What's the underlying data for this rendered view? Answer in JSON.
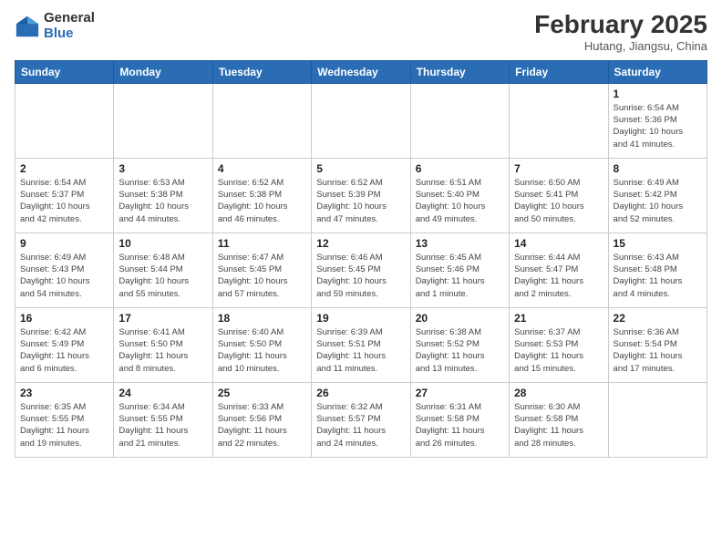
{
  "header": {
    "logo_general": "General",
    "logo_blue": "Blue",
    "month_title": "February 2025",
    "subtitle": "Hutang, Jiangsu, China"
  },
  "weekdays": [
    "Sunday",
    "Monday",
    "Tuesday",
    "Wednesday",
    "Thursday",
    "Friday",
    "Saturday"
  ],
  "weeks": [
    [
      {
        "day": "",
        "info": ""
      },
      {
        "day": "",
        "info": ""
      },
      {
        "day": "",
        "info": ""
      },
      {
        "day": "",
        "info": ""
      },
      {
        "day": "",
        "info": ""
      },
      {
        "day": "",
        "info": ""
      },
      {
        "day": "1",
        "info": "Sunrise: 6:54 AM\nSunset: 5:36 PM\nDaylight: 10 hours\nand 41 minutes."
      }
    ],
    [
      {
        "day": "2",
        "info": "Sunrise: 6:54 AM\nSunset: 5:37 PM\nDaylight: 10 hours\nand 42 minutes."
      },
      {
        "day": "3",
        "info": "Sunrise: 6:53 AM\nSunset: 5:38 PM\nDaylight: 10 hours\nand 44 minutes."
      },
      {
        "day": "4",
        "info": "Sunrise: 6:52 AM\nSunset: 5:38 PM\nDaylight: 10 hours\nand 46 minutes."
      },
      {
        "day": "5",
        "info": "Sunrise: 6:52 AM\nSunset: 5:39 PM\nDaylight: 10 hours\nand 47 minutes."
      },
      {
        "day": "6",
        "info": "Sunrise: 6:51 AM\nSunset: 5:40 PM\nDaylight: 10 hours\nand 49 minutes."
      },
      {
        "day": "7",
        "info": "Sunrise: 6:50 AM\nSunset: 5:41 PM\nDaylight: 10 hours\nand 50 minutes."
      },
      {
        "day": "8",
        "info": "Sunrise: 6:49 AM\nSunset: 5:42 PM\nDaylight: 10 hours\nand 52 minutes."
      }
    ],
    [
      {
        "day": "9",
        "info": "Sunrise: 6:49 AM\nSunset: 5:43 PM\nDaylight: 10 hours\nand 54 minutes."
      },
      {
        "day": "10",
        "info": "Sunrise: 6:48 AM\nSunset: 5:44 PM\nDaylight: 10 hours\nand 55 minutes."
      },
      {
        "day": "11",
        "info": "Sunrise: 6:47 AM\nSunset: 5:45 PM\nDaylight: 10 hours\nand 57 minutes."
      },
      {
        "day": "12",
        "info": "Sunrise: 6:46 AM\nSunset: 5:45 PM\nDaylight: 10 hours\nand 59 minutes."
      },
      {
        "day": "13",
        "info": "Sunrise: 6:45 AM\nSunset: 5:46 PM\nDaylight: 11 hours\nand 1 minute."
      },
      {
        "day": "14",
        "info": "Sunrise: 6:44 AM\nSunset: 5:47 PM\nDaylight: 11 hours\nand 2 minutes."
      },
      {
        "day": "15",
        "info": "Sunrise: 6:43 AM\nSunset: 5:48 PM\nDaylight: 11 hours\nand 4 minutes."
      }
    ],
    [
      {
        "day": "16",
        "info": "Sunrise: 6:42 AM\nSunset: 5:49 PM\nDaylight: 11 hours\nand 6 minutes."
      },
      {
        "day": "17",
        "info": "Sunrise: 6:41 AM\nSunset: 5:50 PM\nDaylight: 11 hours\nand 8 minutes."
      },
      {
        "day": "18",
        "info": "Sunrise: 6:40 AM\nSunset: 5:50 PM\nDaylight: 11 hours\nand 10 minutes."
      },
      {
        "day": "19",
        "info": "Sunrise: 6:39 AM\nSunset: 5:51 PM\nDaylight: 11 hours\nand 11 minutes."
      },
      {
        "day": "20",
        "info": "Sunrise: 6:38 AM\nSunset: 5:52 PM\nDaylight: 11 hours\nand 13 minutes."
      },
      {
        "day": "21",
        "info": "Sunrise: 6:37 AM\nSunset: 5:53 PM\nDaylight: 11 hours\nand 15 minutes."
      },
      {
        "day": "22",
        "info": "Sunrise: 6:36 AM\nSunset: 5:54 PM\nDaylight: 11 hours\nand 17 minutes."
      }
    ],
    [
      {
        "day": "23",
        "info": "Sunrise: 6:35 AM\nSunset: 5:55 PM\nDaylight: 11 hours\nand 19 minutes."
      },
      {
        "day": "24",
        "info": "Sunrise: 6:34 AM\nSunset: 5:55 PM\nDaylight: 11 hours\nand 21 minutes."
      },
      {
        "day": "25",
        "info": "Sunrise: 6:33 AM\nSunset: 5:56 PM\nDaylight: 11 hours\nand 22 minutes."
      },
      {
        "day": "26",
        "info": "Sunrise: 6:32 AM\nSunset: 5:57 PM\nDaylight: 11 hours\nand 24 minutes."
      },
      {
        "day": "27",
        "info": "Sunrise: 6:31 AM\nSunset: 5:58 PM\nDaylight: 11 hours\nand 26 minutes."
      },
      {
        "day": "28",
        "info": "Sunrise: 6:30 AM\nSunset: 5:58 PM\nDaylight: 11 hours\nand 28 minutes."
      },
      {
        "day": "",
        "info": ""
      }
    ]
  ]
}
